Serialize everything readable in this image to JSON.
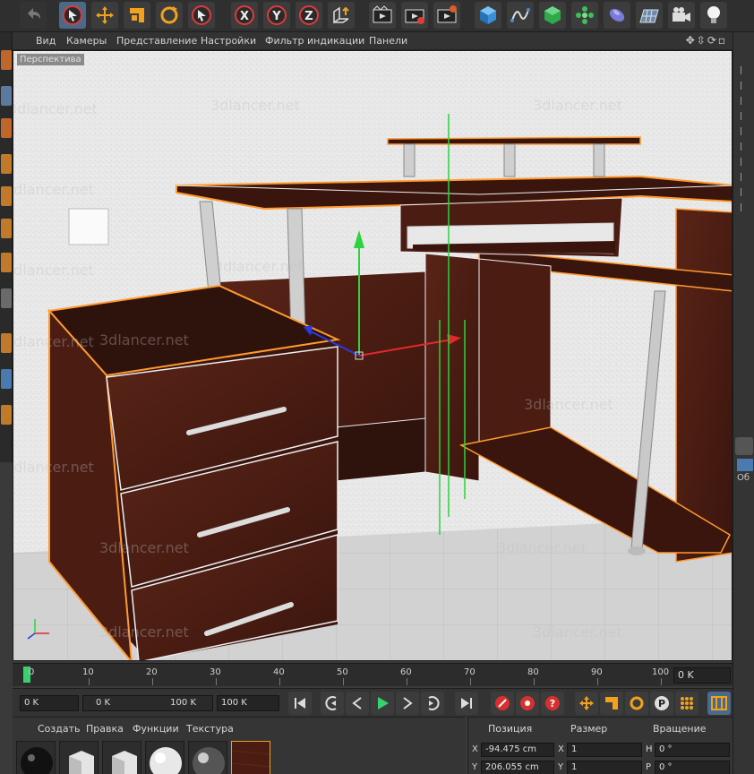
{
  "viewport_menu": {
    "items": [
      "Вид",
      "Камеры",
      "Представление",
      "Настройки",
      "Фильтр индикации",
      "Панели"
    ],
    "label": "Перспектива"
  },
  "toolbar": {
    "axis_x": "X",
    "axis_y": "Y",
    "axis_z": "Z",
    "icons": [
      "undo-icon",
      "select-icon",
      "move-icon",
      "scale-icon",
      "rotate-icon",
      "live-select-icon",
      "axis-x-icon",
      "axis-y-icon",
      "axis-z-icon",
      "coordinate-system-icon",
      "render-view-icon",
      "render-picture-icon",
      "render-settings-icon",
      "cube-icon",
      "spline-icon",
      "nurbs-icon",
      "array-icon",
      "deformer-icon",
      "floor-icon",
      "camera-icon",
      "light-icon"
    ]
  },
  "watermark": "3dlancer.net",
  "timeline": {
    "ticks": [
      "0",
      "10",
      "20",
      "30",
      "40",
      "50",
      "60",
      "70",
      "80",
      "90",
      "100"
    ],
    "current_frame": "0 K"
  },
  "transport": {
    "start_field": "0 K",
    "range_min": "0 K",
    "range_max": "100 K",
    "end_field": "100 K"
  },
  "material_manager": {
    "menu": [
      "Создать",
      "Правка",
      "Функции",
      "Текстура"
    ]
  },
  "coordinates": {
    "headers": [
      "Позиция",
      "Размер",
      "Вращение"
    ],
    "rows": [
      {
        "axis": "X",
        "position": "-94.475 cm",
        "size_axis": "X",
        "size": "1",
        "rot_axis": "H",
        "rotation": "0 °"
      },
      {
        "axis": "Y",
        "position": "206.055 cm",
        "size_axis": "Y",
        "size": "1",
        "rot_axis": "P",
        "rotation": "0 °"
      }
    ]
  },
  "right_panel": {
    "label": "Об"
  },
  "colors": {
    "wood": "#4a1d14",
    "wood_dark": "#2e120c",
    "outline": "#ff9a2e",
    "accent_green": "#38d170",
    "wall": "#e9e9e9",
    "floor": "#d5d5d5"
  }
}
